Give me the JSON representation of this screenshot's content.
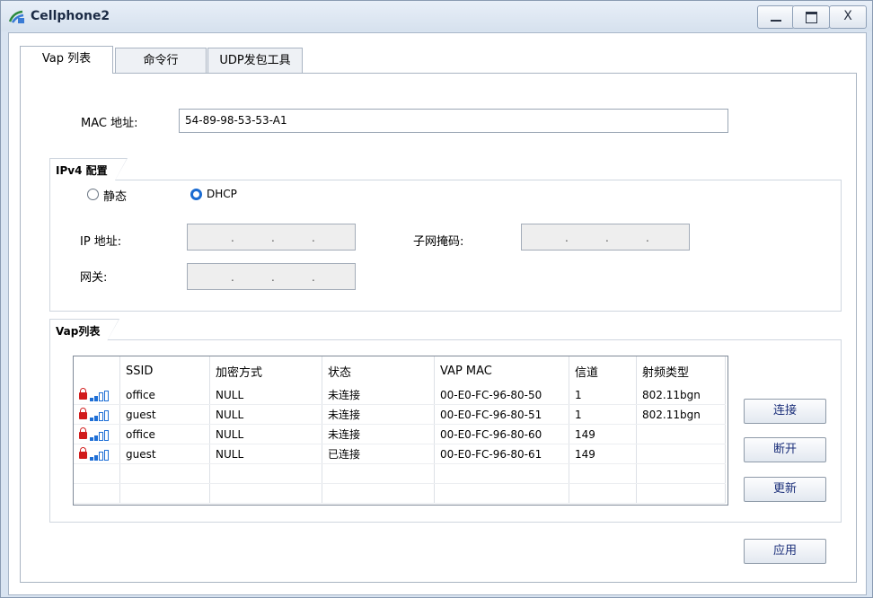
{
  "window": {
    "title": "Cellphone2",
    "min_glyph": "_",
    "max_glyph": "□",
    "close_glyph": "X"
  },
  "tabs": [
    {
      "label": "Vap 列表"
    },
    {
      "label": "命令行"
    },
    {
      "label": "UDP发包工具"
    }
  ],
  "mac": {
    "label": "MAC 地址:",
    "value": "54-89-98-53-53-A1"
  },
  "ipv4": {
    "group_title": "IPv4 配置",
    "radio_static": "静态",
    "radio_dhcp": "DHCP",
    "selected": "DHCP",
    "ip_label": "IP 地址:",
    "subnet_label": "子网掩码:",
    "gateway_label": "网关:",
    "ip_dot": "."
  },
  "vap": {
    "group_title": "Vap列表",
    "columns": [
      "",
      "SSID",
      "加密方式",
      "状态",
      "VAP MAC",
      "信道",
      "射频类型"
    ],
    "rows": [
      {
        "ssid": "office",
        "enc": "NULL",
        "status": "未连接",
        "mac": "00-E0-FC-96-80-50",
        "channel": "1",
        "radio": "802.11bgn"
      },
      {
        "ssid": "guest",
        "enc": "NULL",
        "status": "未连接",
        "mac": "00-E0-FC-96-80-51",
        "channel": "1",
        "radio": "802.11bgn"
      },
      {
        "ssid": "office",
        "enc": "NULL",
        "status": "未连接",
        "mac": "00-E0-FC-96-80-60",
        "channel": "149",
        "radio": ""
      },
      {
        "ssid": "guest",
        "enc": "NULL",
        "status": "已连接",
        "mac": "00-E0-FC-96-80-61",
        "channel": "149",
        "radio": ""
      }
    ]
  },
  "buttons": {
    "connect": "连接",
    "disconnect": "断开",
    "refresh": "更新",
    "apply": "应用"
  },
  "colors": {
    "accent": "#1a6bd1",
    "lock": "#d11b1b",
    "button_text": "#1b2f7a"
  }
}
